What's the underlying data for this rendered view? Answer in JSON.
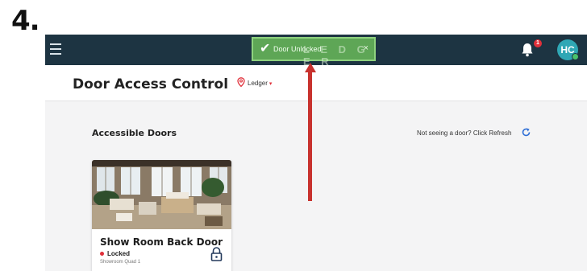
{
  "step_label": "4.",
  "topbar": {
    "toast": {
      "message": "Door Unlocked",
      "brand_watermark": "L E D G E R",
      "close_label": "×"
    },
    "notification_count": "1",
    "avatar_initials": "HC"
  },
  "header": {
    "title": "Door Access Control",
    "org_selector": "Ledger",
    "org_caret": "▾"
  },
  "main": {
    "section_title": "Accessible Doors",
    "refresh_hint": "Not seeing a door? Click Refresh",
    "doors": [
      {
        "name": "Show Room Back Door",
        "status": "Locked",
        "location": "Showroom Quad 1",
        "status_color": "#e0303a"
      }
    ]
  },
  "colors": {
    "topbar": "#1d3442",
    "toast": "#5ea656",
    "accent": "#2fa7b5",
    "danger": "#e0303a",
    "annotation_arrow": "#c8322e"
  },
  "icons": [
    "hamburger-menu-icon",
    "check-icon",
    "close-icon",
    "bell-icon",
    "map-pin-icon",
    "refresh-icon",
    "lock-icon"
  ]
}
